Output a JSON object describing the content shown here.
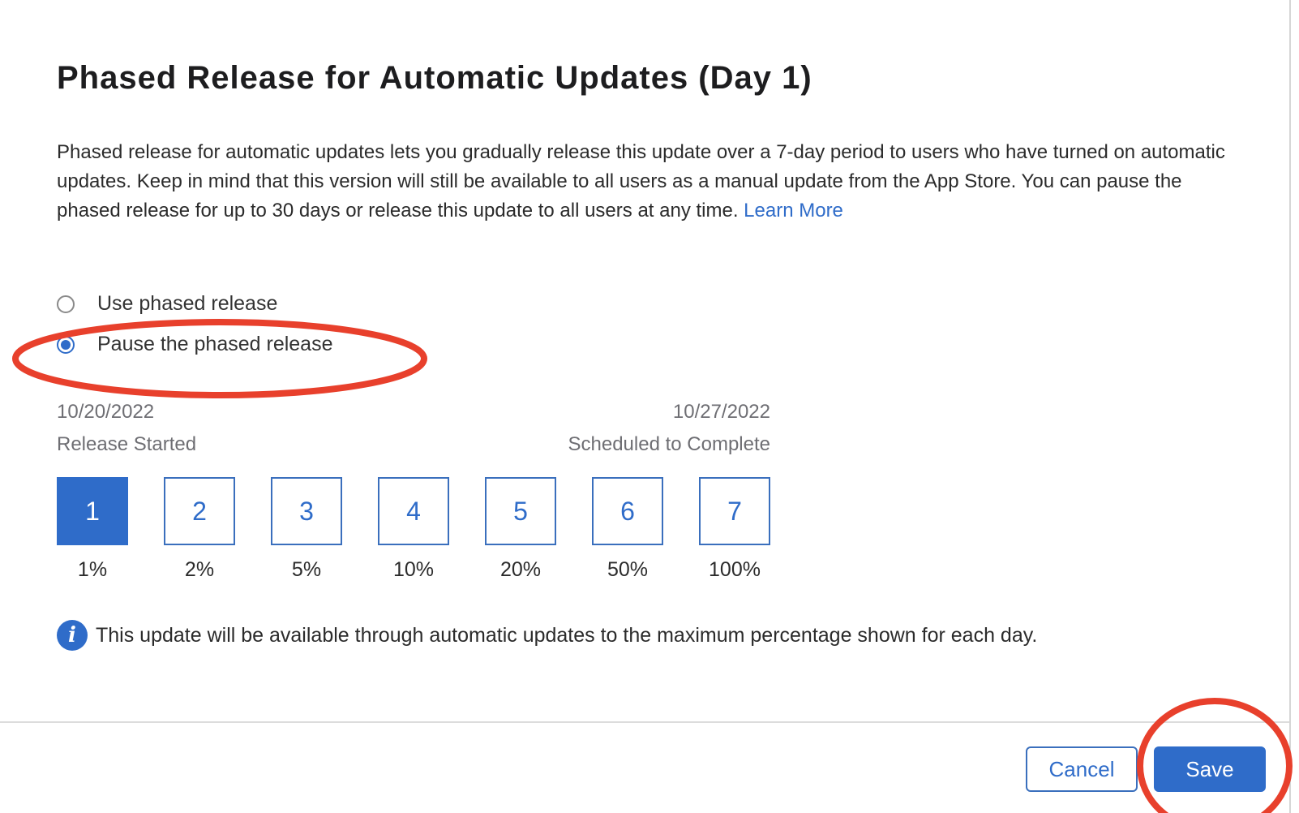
{
  "dialog": {
    "title": "Phased Release for Automatic Updates (Day 1)",
    "description": "Phased release for automatic updates lets you gradually release this update over a 7-day period to users who have turned on automatic updates. Keep in mind that this version will still be available to all users as a manual update from the App Store. You can pause the phased release for up to 30 days or release this update to all users at any time.",
    "learn_more_label": "Learn More"
  },
  "options": {
    "use_label": "Use phased release",
    "use_checked": false,
    "pause_label": "Pause the phased release",
    "pause_checked": true
  },
  "schedule": {
    "start_date": "10/20/2022",
    "start_label": "Release Started",
    "end_date": "10/27/2022",
    "end_label": "Scheduled to Complete"
  },
  "days": [
    {
      "day": "1",
      "percent": "1%",
      "active": true
    },
    {
      "day": "2",
      "percent": "2%",
      "active": false
    },
    {
      "day": "3",
      "percent": "5%",
      "active": false
    },
    {
      "day": "4",
      "percent": "10%",
      "active": false
    },
    {
      "day": "5",
      "percent": "20%",
      "active": false
    },
    {
      "day": "6",
      "percent": "50%",
      "active": false
    },
    {
      "day": "7",
      "percent": "100%",
      "active": false
    }
  ],
  "info": {
    "icon": "info-icon",
    "text": "This update will be available through automatic updates to the maximum percentage shown for each day."
  },
  "footer": {
    "cancel_label": "Cancel",
    "save_label": "Save"
  },
  "colors": {
    "accent": "#2f6cc9",
    "annotation": "#e8402c"
  }
}
